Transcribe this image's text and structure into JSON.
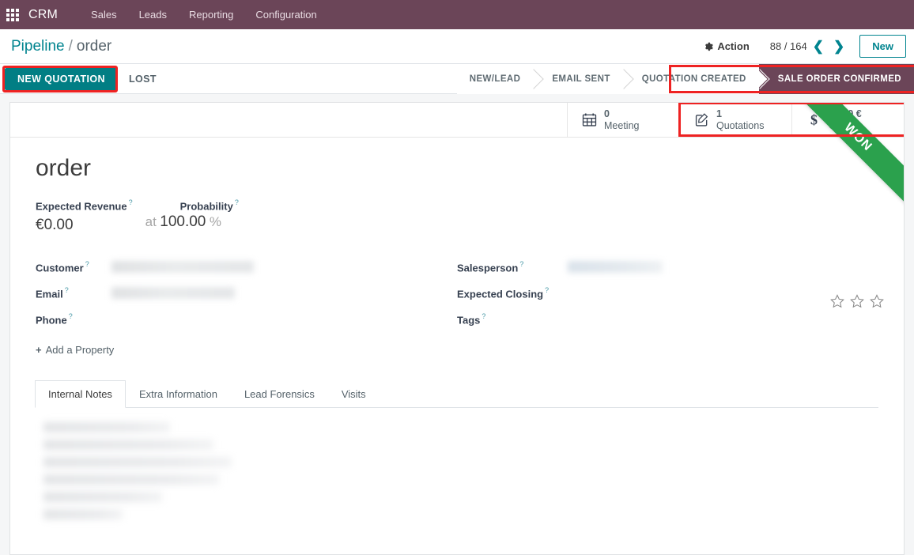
{
  "navbar": {
    "apps_icon": "apps-grid-icon",
    "brand": "CRM",
    "menu": [
      {
        "label": "Sales"
      },
      {
        "label": "Leads"
      },
      {
        "label": "Reporting"
      },
      {
        "label": "Configuration"
      }
    ]
  },
  "control_panel": {
    "breadcrumb": {
      "root": "Pipeline",
      "separator": "/",
      "current": "order"
    },
    "action_label": "Action",
    "action_icon": "gear-icon",
    "pager": {
      "value": "88 / 164",
      "prev_icon": "chevron-left-icon",
      "next_icon": "chevron-right-icon"
    },
    "new_button": "New"
  },
  "statusbar": {
    "buttons": [
      {
        "label": "NEW QUOTATION",
        "style": "primary"
      },
      {
        "label": "LOST",
        "style": "secondary"
      }
    ],
    "stages": [
      {
        "label": "NEW/LEAD",
        "active": false
      },
      {
        "label": "EMAIL SENT",
        "active": false
      },
      {
        "label": "QUOTATION CREATED",
        "active": false
      },
      {
        "label": "SALE ORDER CONFIRMED",
        "active": true
      }
    ],
    "highlight_color": "#ee2222",
    "active_stage_color": "#6b4558",
    "primary_color": "#017e84"
  },
  "stat_buttons": [
    {
      "icon": "calendar-icon",
      "value": "0",
      "label": "Meeting"
    },
    {
      "icon": "pencil-square-icon",
      "value": "1",
      "label": "Quotations"
    },
    {
      "icon": "dollar-icon",
      "value": "94.00 €",
      "label": "Orders"
    }
  ],
  "ribbon": {
    "label": "WON",
    "color": "#2ba14d"
  },
  "form": {
    "title": "order",
    "expected_revenue": {
      "label": "Expected Revenue",
      "help": "?",
      "value": "€0.00"
    },
    "at_word": "at",
    "probability": {
      "label": "Probability",
      "help": "?",
      "value": "100.00",
      "suffix": "%"
    },
    "left_fields": [
      {
        "label": "Customer",
        "help": "?",
        "value": "",
        "redacted": true
      },
      {
        "label": "Email",
        "help": "?",
        "value": "",
        "redacted": true
      },
      {
        "label": "Phone",
        "help": "?",
        "value": "",
        "redacted": false
      }
    ],
    "right_fields": [
      {
        "label": "Salesperson",
        "help": "?",
        "value": "",
        "redacted": true
      },
      {
        "label": "Expected Closing",
        "help": "?",
        "value": "",
        "redacted": false
      },
      {
        "label": "Tags",
        "help": "?",
        "value": "",
        "redacted": false
      }
    ],
    "priority": {
      "icon": "star-outline-icon",
      "stars_total": 3,
      "stars_filled": 0
    },
    "add_property": {
      "plus": "+",
      "label": "Add a Property"
    }
  },
  "notebook": {
    "tabs": [
      {
        "label": "Internal Notes",
        "active": true
      },
      {
        "label": "Extra Information",
        "active": false
      },
      {
        "label": "Lead Forensics",
        "active": false
      },
      {
        "label": "Visits",
        "active": false
      }
    ],
    "internal_notes_content_redacted": true
  }
}
